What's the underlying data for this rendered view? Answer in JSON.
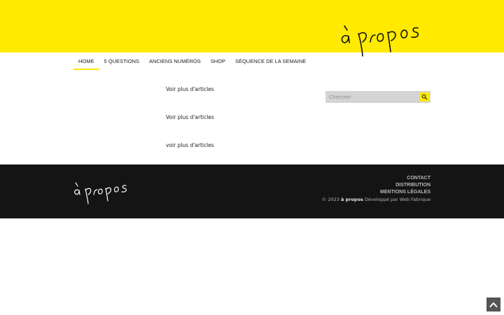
{
  "header": {
    "logo_text": "à propos"
  },
  "nav": [
    {
      "label": "HOME",
      "active": true
    },
    {
      "label": "5 QUESTIONS",
      "active": false
    },
    {
      "label": "ANCIENS NUMÉROS",
      "active": false
    },
    {
      "label": "SHOP",
      "active": false
    },
    {
      "label": "SÉQUENCE DE LA SEMAINE",
      "active": false
    }
  ],
  "main": {
    "links": [
      "Voir plus d'articles",
      "Voir plus d'articles",
      "voir plus d'articles"
    ]
  },
  "search": {
    "placeholder": "Chercher",
    "icon": "search-icon"
  },
  "footer": {
    "logo_text": "à propos",
    "links": [
      "CONTACT",
      "DISTRIBUTION",
      "MENTIONS LÉGALES"
    ],
    "copyright_prefix": "© 2023",
    "copyright_brand": "à propos",
    "copyright_suffix": "Développé par Web Fabrique"
  },
  "scroll_top": {
    "icon": "chevron-up-icon"
  },
  "colors": {
    "brand_yellow": "#ffea00",
    "footer_bg": "#141414"
  }
}
